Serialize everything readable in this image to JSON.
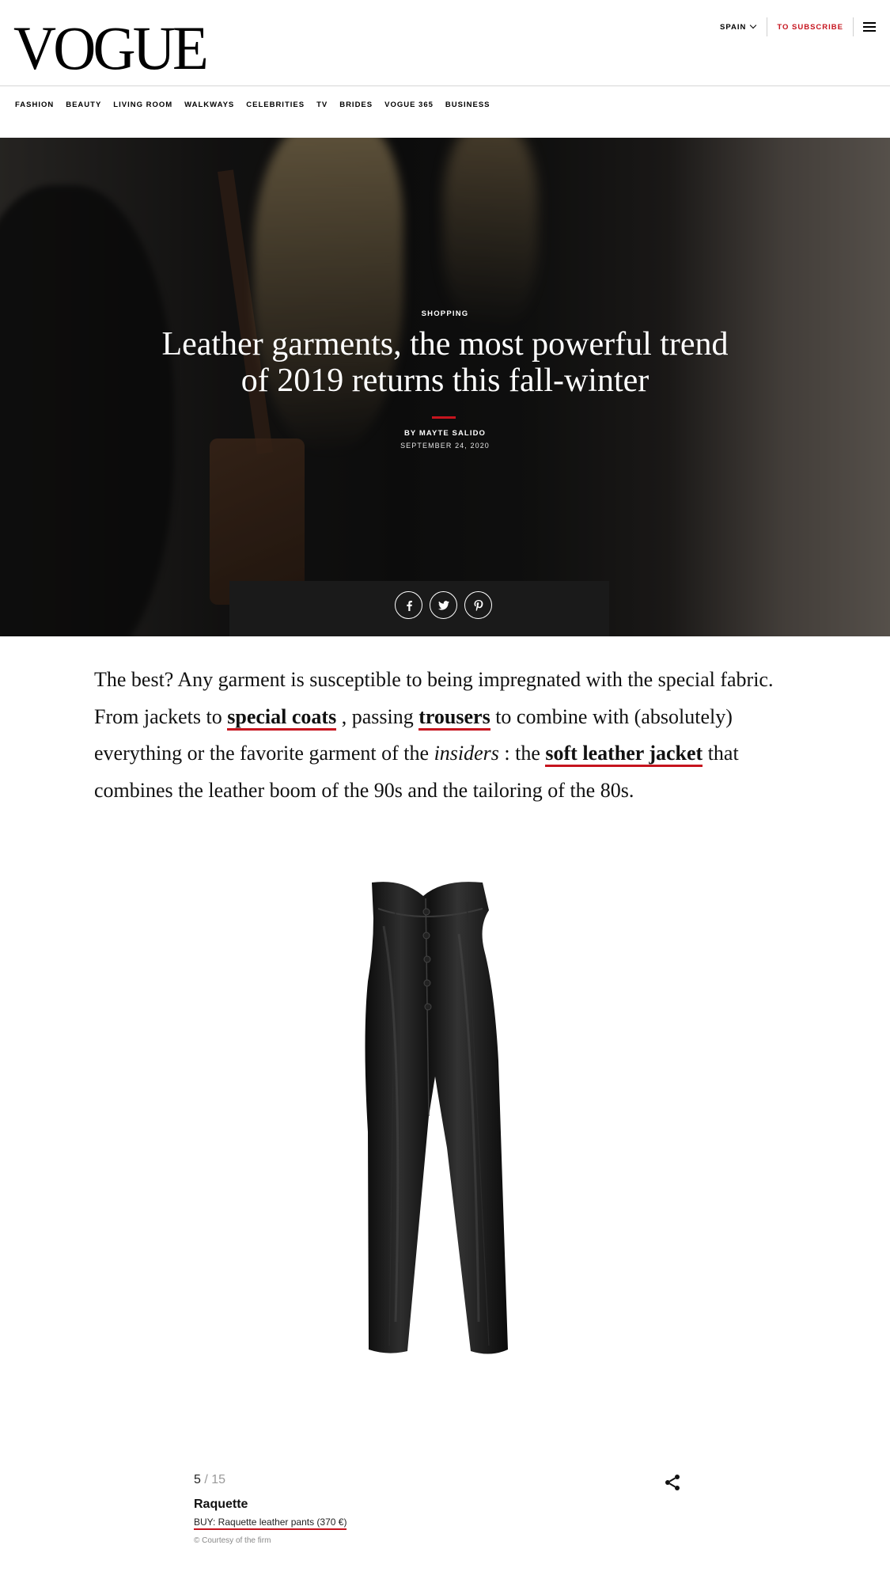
{
  "header": {
    "logo": "VOGUE",
    "region": "SPAIN",
    "subscribe": "TO SUBSCRIBE"
  },
  "nav": {
    "items": [
      "FASHION",
      "BEAUTY",
      "LIVING ROOM",
      "WALKWAYS",
      "CELEBRITIES",
      "TV",
      "BRIDES",
      "VOGUE 365",
      "BUSINESS"
    ]
  },
  "hero": {
    "kicker": "SHOPPING",
    "title": "Leather garments, the most powerful trend of 2019 returns this fall-winter",
    "byline": "BY MAYTE SALIDO",
    "date": "SEPTEMBER 24, 2020",
    "share_icons": [
      "facebook-icon",
      "twitter-icon",
      "pinterest-icon"
    ]
  },
  "article": {
    "p1": "The best? Any garment is susceptible to being impregnated with the special fabric. From jackets to ",
    "link1": "special coats",
    "p2": " , passing ",
    "link2": "trousers",
    "p3": " to combine with (absolutely) everything or the favorite garment of the ",
    "em": "insiders",
    "p4": " : the ",
    "link3": "soft leather jacket",
    "p5": " that combines the leather boom of the 90s and the tailoring of the 80s."
  },
  "gallery": {
    "current": "5",
    "separator": "/",
    "total": "15",
    "brand": "Raquette",
    "buy_link": "BUY: Raquette leather pants (370 €)",
    "credit": "© Courtesy of the firm"
  },
  "colors": {
    "accent": "#c6141e",
    "text": "#111111"
  }
}
